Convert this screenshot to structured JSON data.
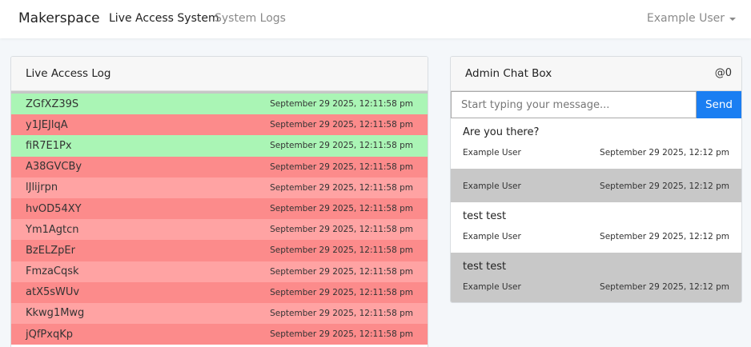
{
  "nav": {
    "brand": "Makerspace",
    "links": [
      "Live Access System",
      "System Logs"
    ],
    "user": "Example User"
  },
  "access_log": {
    "title": "Live Access Log",
    "rows": [
      {
        "code": "ZGfXZ39S",
        "time": "September 29 2025, 12:11:58 pm",
        "color": "#aaf5b5"
      },
      {
        "code": "y1JEJlqA",
        "time": "September 29 2025, 12:11:58 pm",
        "color": "#fc8b8b"
      },
      {
        "code": "fiR7E1Px",
        "time": "September 29 2025, 12:11:58 pm",
        "color": "#aaf5b5"
      },
      {
        "code": "A38GVCBy",
        "time": "September 29 2025, 12:11:58 pm",
        "color": "#fc8b8b"
      },
      {
        "code": "lJlijrpn",
        "time": "September 29 2025, 12:11:58 pm",
        "color": "#ffa3a3"
      },
      {
        "code": "hvOD54XY",
        "time": "September 29 2025, 12:11:58 pm",
        "color": "#fc8b8b"
      },
      {
        "code": "Ym1Agtcn",
        "time": "September 29 2025, 12:11:58 pm",
        "color": "#ffa3a3"
      },
      {
        "code": "BzELZpEr",
        "time": "September 29 2025, 12:11:58 pm",
        "color": "#fc8b8b"
      },
      {
        "code": "FmzaCqsk",
        "time": "September 29 2025, 12:11:58 pm",
        "color": "#ffa3a3"
      },
      {
        "code": "atX5sWUv",
        "time": "September 29 2025, 12:11:58 pm",
        "color": "#fc8b8b"
      },
      {
        "code": "Kkwg1Mwg",
        "time": "September 29 2025, 12:11:58 pm",
        "color": "#ffa3a3"
      },
      {
        "code": "jQfPxqKp",
        "time": "September 29 2025, 12:11:58 pm",
        "color": "#fc8b8b"
      }
    ]
  },
  "chat": {
    "title": "Admin Chat Box",
    "count": "@0",
    "placeholder": "Start typing your message...",
    "send_label": "Send",
    "messages": [
      {
        "text": "Are you there?",
        "user": "Example User",
        "time": "September 29 2025, 12:12 pm",
        "bg": "#ffffff"
      },
      {
        "text": "",
        "user": "Example User",
        "time": "September 29 2025, 12:12 pm",
        "bg": "#c8c8c8"
      },
      {
        "text": "test test",
        "user": "Example User",
        "time": "September 29 2025, 12:12 pm",
        "bg": "#ffffff"
      },
      {
        "text": "test test",
        "user": "Example User",
        "time": "September 29 2025, 12:12 pm",
        "bg": "#c8c8c8"
      }
    ]
  }
}
